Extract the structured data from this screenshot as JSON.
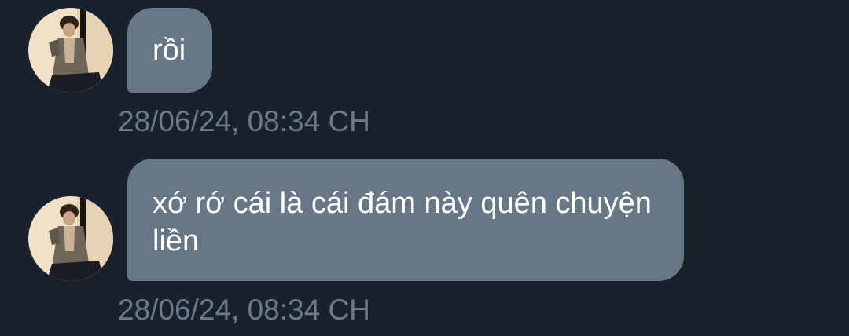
{
  "messages": [
    {
      "avatar": "user-avatar",
      "text": "rồi",
      "timestamp": "28/06/24, 08:34 CH"
    },
    {
      "avatar": "user-avatar",
      "text": "xớ rớ cái là cái đám này quên chuyện liền",
      "timestamp": "28/06/24, 08:34 CH"
    }
  ],
  "colors": {
    "background": "#19212c",
    "bubble": "#677786",
    "bubble_text": "#ffffff",
    "timestamp": "#6c7b8a"
  }
}
